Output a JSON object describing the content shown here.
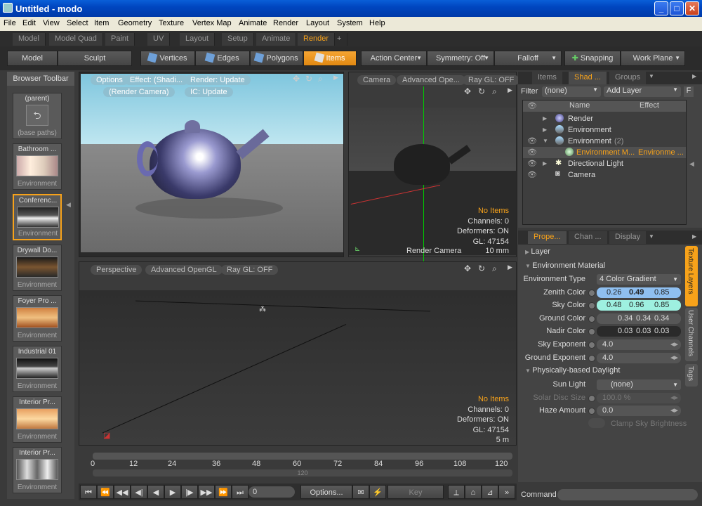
{
  "window": {
    "title": "Untitled - modo",
    "min": "_",
    "max": "□",
    "close": "✕"
  },
  "menu": [
    "File",
    "Edit",
    "View",
    "Select",
    "Item",
    "Geometry",
    "Texture",
    "Vertex Map",
    "Animate",
    "Render",
    "Layout",
    "System",
    "Help"
  ],
  "layout_tabs": [
    "Model",
    "Model Quad",
    "Paint",
    "UV",
    "Layout",
    "Setup",
    "Animate",
    "Render",
    "+"
  ],
  "toolbar": {
    "model": "Model",
    "sculpt": "Sculpt",
    "vertices": "Vertices",
    "edges": "Edges",
    "polygons": "Polygons",
    "items": "Items",
    "action_center": "Action Center",
    "symmetry": "Symmetry: Off",
    "falloff": "Falloff",
    "snapping": "Snapping",
    "work_plane": "Work Plane"
  },
  "browser": {
    "title": "Browser Toolbar",
    "items": [
      {
        "name": "(parent)",
        "sub": "(base paths)"
      },
      {
        "name": "Bathroom ...",
        "sub": "Environment"
      },
      {
        "name": "Conferenc...",
        "sub": "Environment"
      },
      {
        "name": "Drywall Do...",
        "sub": "Environment"
      },
      {
        "name": "Foyer Pro ...",
        "sub": "Environment"
      },
      {
        "name": "Industrial 01",
        "sub": "Environment"
      },
      {
        "name": "Interior Pr...",
        "sub": "Environment"
      },
      {
        "name": "Interior Pr...",
        "sub": "Environment"
      }
    ]
  },
  "render_view": {
    "options": "Options",
    "effect": "Effect: (Shadi...",
    "render": "Render: Update",
    "camera": "(Render Camera)",
    "ic": "IC: Update"
  },
  "camera_view": {
    "camera": "Camera",
    "mode": "Advanced Ope...",
    "raygl": "Ray GL: OFF",
    "no_items": "No Items",
    "channels": "Channels: 0",
    "deformers": "Deformers: ON",
    "gl": "GL: 47154",
    "name": "Render Camera",
    "scale": "10 mm"
  },
  "persp_view": {
    "perspective": "Perspective",
    "mode": "Advanced OpenGL",
    "raygl": "Ray GL: OFF",
    "no_items": "No Items",
    "channels": "Channels: 0",
    "deformers": "Deformers: ON",
    "gl": "GL: 47154",
    "scale": "5 m"
  },
  "timeline": {
    "ticks": [
      "0",
      "12",
      "24",
      "36",
      "48",
      "60",
      "72",
      "84",
      "96",
      "108",
      "120"
    ],
    "end": "120",
    "frame": "0",
    "options": "Options...",
    "key": "Key"
  },
  "shader": {
    "tabs": [
      "Items",
      "Shad ...",
      "Groups"
    ],
    "filter_label": "Filter",
    "filter": "(none)",
    "add_layer": "Add Layer",
    "f": "F",
    "col_name": "Name",
    "col_effect": "Effect",
    "rows": [
      {
        "name": "Render",
        "effect": ""
      },
      {
        "name": "Environment",
        "effect": ""
      },
      {
        "name": "Environment",
        "effect": "(2)"
      },
      {
        "name": "Environment M...",
        "effect": "Environme ..."
      },
      {
        "name": "Directional Light",
        "effect": ""
      },
      {
        "name": "Camera",
        "effect": ""
      }
    ]
  },
  "props": {
    "tabs": [
      "Prope...",
      "Chan ...",
      "Display"
    ],
    "side_tabs": [
      "Texture Layers",
      "User Channels",
      "Tags"
    ],
    "layer": "Layer",
    "env_material": "Environment Material",
    "env_type_label": "Environment Type",
    "env_type": "4 Color Gradient",
    "zenith_label": "Zenith Color",
    "zenith": [
      "0.26",
      "0.49",
      "0.85"
    ],
    "sky_label": "Sky Color",
    "sky": [
      "0.48",
      "0.96",
      "0.85"
    ],
    "ground_label": "Ground Color",
    "ground": [
      "0.34",
      "0.34",
      "0.34"
    ],
    "nadir_label": "Nadir Color",
    "nadir": [
      "0.03",
      "0.03",
      "0.03"
    ],
    "sky_exp_label": "Sky Exponent",
    "sky_exp": "4.0",
    "ground_exp_label": "Ground Exponent",
    "ground_exp": "4.0",
    "daylight": "Physically-based Daylight",
    "sun_label": "Sun Light",
    "sun": "(none)",
    "solar_label": "Solar Disc Size",
    "solar": "100.0 %",
    "haze_label": "Haze Amount",
    "haze": "0.0",
    "clamp": "Clamp Sky Brightness"
  },
  "command_label": "Command",
  "colors": {
    "accent": "#f7a21a",
    "zenith": "#8fbff0",
    "sky": "#9ef0e0"
  }
}
